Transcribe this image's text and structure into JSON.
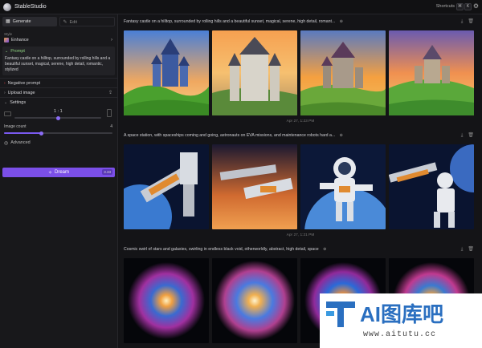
{
  "app": {
    "title": "StableStudio",
    "shortcuts_label": "Shortcuts",
    "shortcut_keys": [
      "⌘",
      "K"
    ]
  },
  "sidebar": {
    "tabs": [
      {
        "label": "Generate",
        "active": true
      },
      {
        "label": "Edit",
        "active": false
      }
    ],
    "style": {
      "section_label": "Style",
      "value": "Enhance"
    },
    "prompt": {
      "label": "Prompt",
      "text": "Fantasy castle on a hilltop, surrounded by rolling hills and a beautiful sunset, magical, serene, high detail, romantic, stylized"
    },
    "negative_prompt": {
      "label": "Negative prompt"
    },
    "upload_image": {
      "label": "Upload image"
    },
    "settings": {
      "label": "Settings",
      "aspect_ratio": "1 : 1",
      "image_count_label": "Image count",
      "image_count_value": "4",
      "advanced_label": "Advanced"
    },
    "dream": {
      "label": "Dream",
      "badge": "3.33"
    }
  },
  "generations": [
    {
      "prompt": "Fantasy castle on a hilltop, surrounded by rolling hills and a beautiful sunset, magical, serene, high detail, romant...",
      "timestamp": "Apr 27, 1:23 PM"
    },
    {
      "prompt": "A space station, with spaceships coming and going, astronauts on EVA missions, and maintenance robots hard a...",
      "timestamp": "Apr 27, 1:21 PM"
    },
    {
      "prompt": "Cosmic swirl of stars and galaxies, swirling in endless black void, otherworldly, abstract, high detail, space",
      "timestamp": ""
    }
  ],
  "watermark": {
    "title": "AI图库吧",
    "url": "www.aitutu.cc"
  },
  "colors": {
    "accent": "#7b4fe8",
    "background": "#141417",
    "sidebar": "#18181b"
  }
}
